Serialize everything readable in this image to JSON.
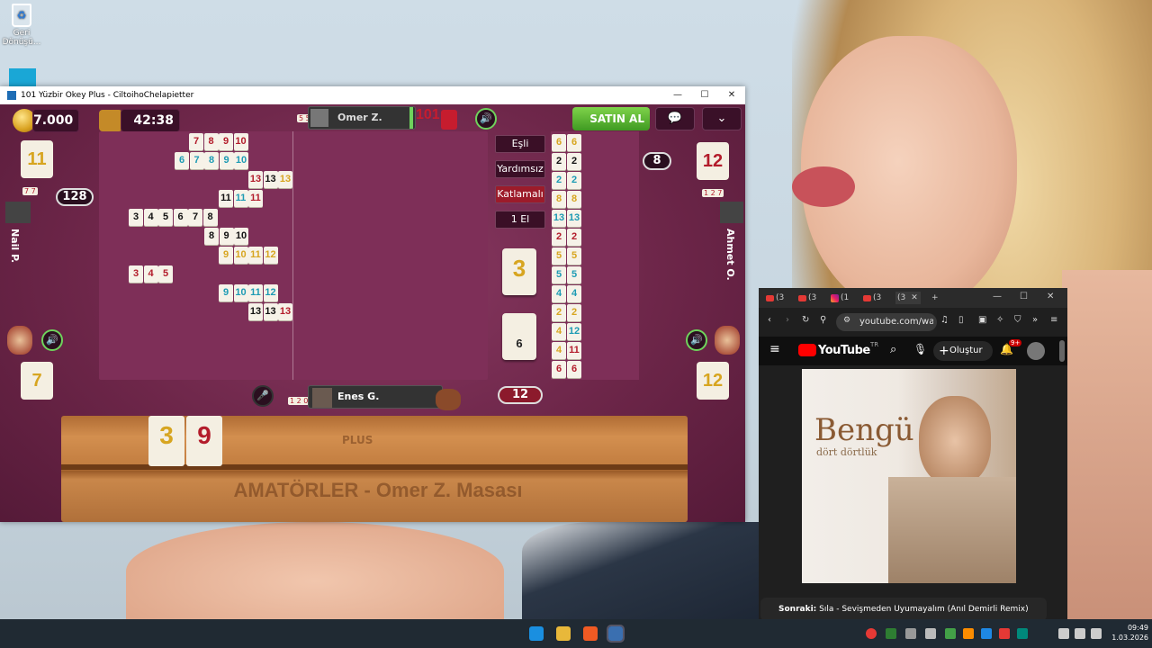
{
  "desktop": {
    "icons": [
      {
        "label": "Geri Dönüşü..."
      }
    ]
  },
  "game_window": {
    "title": "101 Yüzbir Okey Plus - CiltoihoChelapietter",
    "coins": "7.000",
    "timer": "42:38",
    "buy_label": "SATIN AL",
    "top_player": {
      "name": "Omer Z.",
      "count": "101",
      "mini_tiles": "5 5"
    },
    "bottom_player": {
      "name": "Enes G.",
      "mini_tiles": "1 2 0"
    },
    "left_player": {
      "name": "Nail P.",
      "score": "128",
      "mini_tiles": "7 7"
    },
    "right_player": {
      "name": "Ahmet O.",
      "score": "8",
      "mini_tiles": "1 2 7"
    },
    "side_tiles": {
      "left_top": "11",
      "right_top": "12",
      "left_bottom": "7",
      "right_bottom": "12"
    },
    "options": [
      "Eşli",
      "Yardımsız",
      "Katlamalı",
      "1 El"
    ],
    "indicator_tile": "3",
    "deck_count": "6",
    "bottom_count": "12",
    "rack_tiles": [
      "3",
      "9"
    ],
    "rack_caption": "AMATÖRLER - Omer Z. Masası",
    "rack_logo": "PLUS",
    "melds": [
      [
        {
          "n": "7",
          "c": "r"
        },
        {
          "n": "8",
          "c": "r"
        },
        {
          "n": "9",
          "c": "r"
        },
        {
          "n": "10",
          "c": "r"
        }
      ],
      [
        {
          "n": "6",
          "c": "b"
        },
        {
          "n": "7",
          "c": "b"
        },
        {
          "n": "8",
          "c": "b"
        },
        {
          "n": "9",
          "c": "b"
        },
        {
          "n": "10",
          "c": "b"
        }
      ],
      [
        {
          "n": "13",
          "c": "r"
        },
        {
          "n": "13",
          "c": "k"
        },
        {
          "n": "13",
          "c": "y"
        }
      ],
      [
        {
          "n": "11",
          "c": "k"
        },
        {
          "n": "11",
          "c": "b"
        },
        {
          "n": "11",
          "c": "r"
        }
      ],
      [
        {
          "n": "3",
          "c": "k"
        },
        {
          "n": "4",
          "c": "k"
        },
        {
          "n": "5",
          "c": "k"
        },
        {
          "n": "6",
          "c": "k"
        },
        {
          "n": "7",
          "c": "k"
        },
        {
          "n": "8",
          "c": "k"
        }
      ],
      [
        {
          "n": "8",
          "c": "k"
        },
        {
          "n": "9",
          "c": "k"
        },
        {
          "n": "10",
          "c": "k"
        }
      ],
      [
        {
          "n": "9",
          "c": "y"
        },
        {
          "n": "10",
          "c": "y"
        },
        {
          "n": "11",
          "c": "y"
        },
        {
          "n": "12",
          "c": "y"
        }
      ],
      [
        {
          "n": "3",
          "c": "r"
        },
        {
          "n": "4",
          "c": "r"
        },
        {
          "n": "5",
          "c": "r"
        }
      ],
      [
        {
          "n": "9",
          "c": "b"
        },
        {
          "n": "10",
          "c": "b"
        },
        {
          "n": "11",
          "c": "b"
        },
        {
          "n": "12",
          "c": "b"
        }
      ],
      [
        {
          "n": "13",
          "c": "k"
        },
        {
          "n": "13",
          "c": "k"
        },
        {
          "n": "13",
          "c": "r"
        }
      ]
    ],
    "pairs": [
      [
        {
          "n": "6",
          "c": "y"
        },
        {
          "n": "6",
          "c": "y"
        }
      ],
      [
        {
          "n": "2",
          "c": "k"
        },
        {
          "n": "2",
          "c": "k"
        }
      ],
      [
        {
          "n": "2",
          "c": "b"
        },
        {
          "n": "2",
          "c": "b"
        }
      ],
      [
        {
          "n": "8",
          "c": "y"
        },
        {
          "n": "8",
          "c": "y"
        }
      ],
      [
        {
          "n": "13",
          "c": "b"
        },
        {
          "n": "13",
          "c": "b"
        }
      ],
      [
        {
          "n": "2",
          "c": "r"
        },
        {
          "n": "2",
          "c": "r"
        }
      ],
      [
        {
          "n": "5",
          "c": "y"
        },
        {
          "n": "5",
          "c": "y"
        }
      ],
      [
        {
          "n": "5",
          "c": "b"
        },
        {
          "n": "5",
          "c": "b"
        }
      ],
      [
        {
          "n": "4",
          "c": "b"
        },
        {
          "n": "4",
          "c": "b"
        }
      ],
      [
        {
          "n": "2",
          "c": "y"
        },
        {
          "n": "2",
          "c": "y"
        }
      ],
      [
        {
          "n": "4",
          "c": "y"
        },
        {
          "n": "12",
          "c": "b"
        }
      ],
      [
        {
          "n": "4",
          "c": "y"
        },
        {
          "n": "11",
          "c": "r"
        }
      ],
      [
        {
          "n": "6",
          "c": "r"
        },
        {
          "n": "6",
          "c": "r"
        }
      ]
    ]
  },
  "browser": {
    "tabs": [
      "(3",
      "(3",
      "(1",
      "(3",
      "(3"
    ],
    "url": "youtube.com/watch",
    "yt_logo_text": "YouTube",
    "yt_region": "TR",
    "create_label": "Oluştur",
    "notif_count": "9+",
    "album_artist": "Bengü",
    "album_title": "dört dörtlük",
    "up_next_label": "Sonraki:",
    "up_next_title": "Sıla - Sevişmeden Uyumayalım (Anıl Demirli Remix)"
  },
  "taskbar": {
    "time": "09:49",
    "date": "1.03.2026"
  },
  "colors": {
    "r": "#b31c2b",
    "b": "#1d9bb4",
    "k": "#111111",
    "y": "#d7a520"
  }
}
